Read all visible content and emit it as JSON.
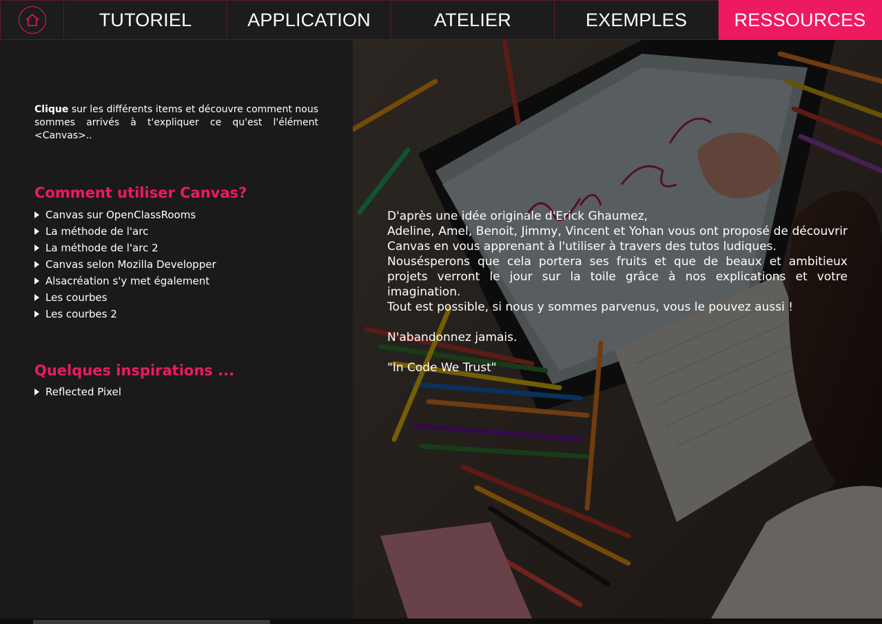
{
  "nav": {
    "home_icon": "home-icon",
    "tabs": [
      {
        "label": "TUTORIEL"
      },
      {
        "label": "APPLICATION"
      },
      {
        "label": "ATELIER"
      },
      {
        "label": "EXEMPLES"
      },
      {
        "label": "RESSOURCES",
        "active": true
      }
    ],
    "accent_color": "#ee1a5f"
  },
  "intro": {
    "bold": "Clique",
    "text": " sur les différents items et découvre comment nous sommes arrivés à t'expliquer ce qu'est l'élément <Canvas>.."
  },
  "sections": [
    {
      "title": "Comment utiliser Canvas?",
      "links": [
        "Canvas sur OpenClassRooms",
        "La méthode de l'arc",
        "La méthode de l'arc 2",
        "Canvas selon Mozilla Developper",
        "Alsacréation s'y met également",
        "Les courbes",
        "Les courbes 2"
      ]
    },
    {
      "title": "Quelques inspirations ...",
      "links": [
        "Reflected Pixel"
      ]
    }
  ],
  "credits": {
    "line1": "D'après une idée originale d'Erick Ghaumez,",
    "line2": "Adeline, Amel, Benoit, Jimmy, Vincent et Yohan vous ont proposé de découvrir Canvas en vous apprenant à l'utiliser à travers des tutos ludiques.",
    "line3": "Nousésperons que cela portera ses fruits et que de beaux et ambitieux projets verront le jour sur la toile grâce à nos explications et votre imagination.",
    "line4": "Tout est possible, si nous y sommes parvenus, vous le pouvez aussi !",
    "line5": "N'abandonnez jamais.",
    "line6": "\"In Code We Trust\""
  },
  "photo": {
    "screen_writing": "Yes, we Canvas"
  }
}
